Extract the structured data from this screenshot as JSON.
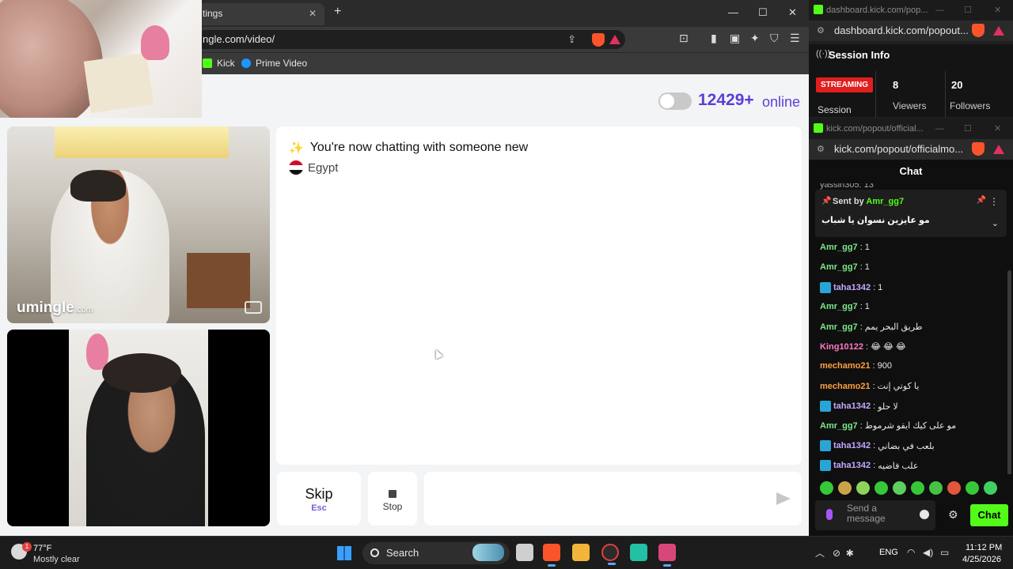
{
  "browser": {
    "tab_title": "tings",
    "url": "ngle.com/video/",
    "bookmarks": [
      {
        "label": "Kick",
        "icon": "kick-icon",
        "color": "#53fc18"
      },
      {
        "label": "Prime Video",
        "icon": "prime-video-icon",
        "color": "#1a98ff"
      }
    ]
  },
  "site": {
    "online_count": "12429+",
    "online_label": "online",
    "watermark_brand": "umingle",
    "watermark_domain": ".com",
    "system_message": "You're now chatting with someone new",
    "country": "Egypt",
    "skip_label": "Skip",
    "skip_key": "Esc",
    "stop_label": "Stop",
    "message_placeholder": "",
    "accent_color": "#5b3fd6"
  },
  "kick_dashboard": {
    "title": "dashboard.kick.com/pop...",
    "url": "dashboard.kick.com/popout...",
    "session_title": "Session Info",
    "streaming_badge": "STREAMING",
    "session_label": "Session",
    "viewers_count": "8",
    "viewers_label": "Viewers",
    "followers_count": "20",
    "followers_label": "Followers"
  },
  "kick_chat": {
    "title": "kick.com/popout/official...",
    "url": "kick.com/popout/officialmo...",
    "header": "Chat",
    "cut_message": "yassin305: 13",
    "pinned": {
      "sent_by_label": "Sent by",
      "user": "Amr_gg7",
      "text": "مو عايزين نسوان يا شباب"
    },
    "messages": [
      {
        "user": "Amr_gg7",
        "text": "1",
        "color": "#7ee787",
        "badge": false
      },
      {
        "user": "Amr_gg7",
        "text": "1",
        "color": "#7ee787",
        "badge": false
      },
      {
        "user": "taha1342",
        "text": "1",
        "color": "#c4a7ff",
        "badge": true
      },
      {
        "user": "Amr_gg7",
        "text": "1",
        "color": "#7ee787",
        "badge": false
      },
      {
        "user": "Amr_gg7",
        "text": "طريق البحر يمم",
        "color": "#7ee787",
        "badge": false
      },
      {
        "user": "King10122",
        "text": "😂 😂 😂",
        "color": "#ff7ac6",
        "badge": false
      },
      {
        "user": "mechamo21",
        "text": "900",
        "color": "#ff9f40",
        "badge": false
      },
      {
        "user": "mechamo21",
        "text": "يا كوتي إنت",
        "color": "#ff9f40",
        "badge": false
      },
      {
        "user": "taha1342",
        "text": "لا حلو",
        "color": "#c4a7ff",
        "badge": true
      },
      {
        "user": "Amr_gg7",
        "text": "مو على كيك ايقو شرموط",
        "color": "#7ee787",
        "badge": false
      },
      {
        "user": "taha1342",
        "text": "بلعب في بضاني",
        "color": "#c4a7ff",
        "badge": true
      },
      {
        "user": "taha1342",
        "text": "علب فاضيه",
        "color": "#c4a7ff",
        "badge": true
      }
    ],
    "input_placeholder": "Send a message",
    "chat_button": "Chat",
    "brand_color": "#53fc18"
  },
  "taskbar": {
    "temperature": "77°F",
    "weather": "Mostly clear",
    "weather_badge": "1",
    "search_label": "Search",
    "language": "ENG",
    "time": "11:12 PM",
    "date": "4/25/2026"
  }
}
